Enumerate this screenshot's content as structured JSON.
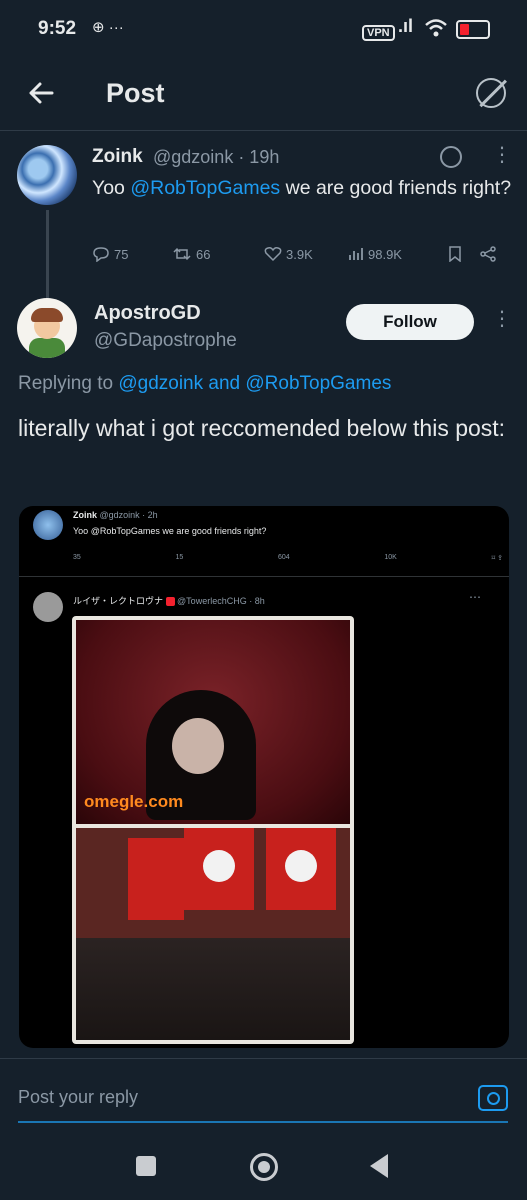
{
  "status": {
    "time": "9:52",
    "notif": "⊕ ···",
    "vpn": "VPN",
    "signal": ".ıl"
  },
  "header": {
    "title": "Post",
    "back_icon": "back-arrow-icon",
    "grok_icon": "grok-icon"
  },
  "original_post": {
    "name": "Zoink",
    "handle_time": "@gdzoink · 19h",
    "text_before": "Yoo ",
    "mention": "@RobTopGames",
    "text_after": " we are good friends right?",
    "replies": "75",
    "reposts": "66",
    "likes": "3.9K",
    "views": "98.9K"
  },
  "reply_post": {
    "name": "ApostroGD",
    "handle": "@GDapostrophe",
    "follow_label": "Follow",
    "replying_prefix": "Replying to ",
    "replying_users": "@gdzoink and @RobTopGames",
    "text": "literally what i got reccomended below this post:"
  },
  "media": {
    "embed_name": "Zoink",
    "embed_handle": "@gdzoink · 2h",
    "embed_text": "Yoo @RobTopGames we are good friends right?",
    "embed_metrics": [
      "35",
      "15",
      "604",
      "10K"
    ],
    "second_name": "ルイザ・レクトロヴナ",
    "second_handle": "@TowerlechCHG · 8h",
    "omegle_text": "omegle.com"
  },
  "composer": {
    "placeholder": "Post your reply"
  },
  "colors": {
    "background": "#15202b",
    "accent": "#1d9bf0",
    "text": "#e7e9ea",
    "muted": "#8b98a5"
  }
}
